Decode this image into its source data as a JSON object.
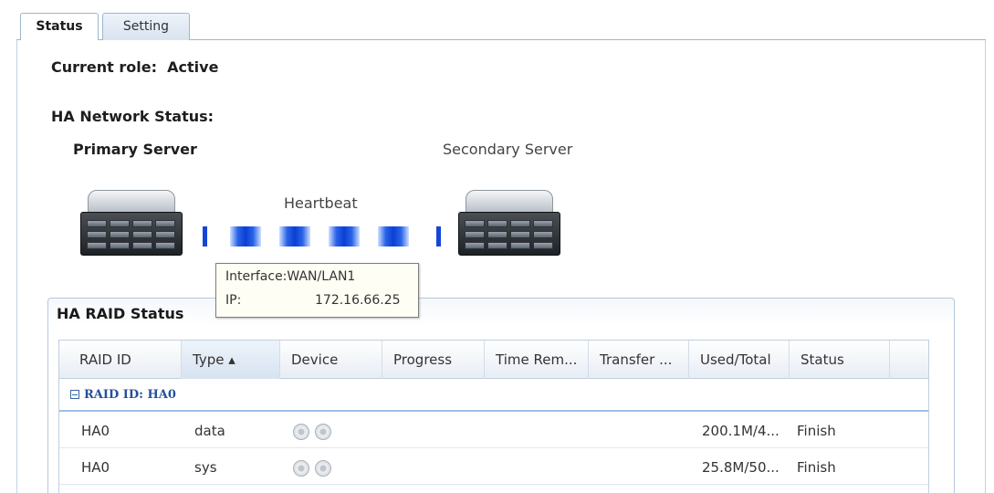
{
  "tabs": [
    {
      "label": "Status",
      "active": true
    },
    {
      "label": "Setting",
      "active": false
    }
  ],
  "current_role": {
    "label": "Current role:",
    "value": "Active"
  },
  "network": {
    "title": "HA Network Status:",
    "primary_label": "Primary Server",
    "secondary_label": "Secondary Server",
    "heartbeat_label": "Heartbeat",
    "tooltip": {
      "interface_label": "Interface:",
      "interface_value": "WAN/LAN1",
      "ip_label": "IP:",
      "ip_value": "172.16.66.25"
    }
  },
  "raid": {
    "title": "HA RAID Status",
    "columns": [
      "RAID ID",
      "Type ▴",
      "Device",
      "Progress",
      "Time Rem...",
      "Transfer ...",
      "Used/Total",
      "Status"
    ],
    "group_label": "RAID ID: HA0",
    "rows": [
      {
        "raid_id": "HA0",
        "type": "data",
        "progress": "",
        "time_rem": "",
        "transfer": "",
        "used_total": "200.1M/4...",
        "status": "Finish"
      },
      {
        "raid_id": "HA0",
        "type": "sys",
        "progress": "",
        "time_rem": "",
        "transfer": "",
        "used_total": "25.8M/50...",
        "status": "Finish"
      }
    ]
  },
  "colors": {
    "heartbeat": "#1446d8",
    "group_text": "#25509a",
    "tab_border": "#9fb5cc"
  },
  "icons": {
    "server": "server-icon",
    "device": "disk-icon",
    "collapse": "collapse-toggle-icon"
  }
}
